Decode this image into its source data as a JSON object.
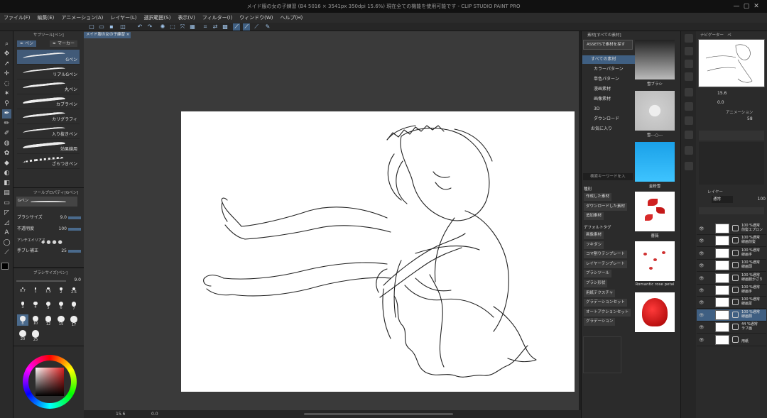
{
  "window": {
    "title": "メイド服の女の子練習 (B4 5016 × 3541px 350dpi 15.6%)  現在全ての機能を使用可能です - CLIP STUDIO PAINT PRO",
    "controls": [
      "—",
      "▢",
      "✕"
    ]
  },
  "menu": [
    "ファイル(F)",
    "編集(E)",
    "アニメーション(A)",
    "レイヤー(L)",
    "選択範囲(S)",
    "表示(V)",
    "フィルター(I)",
    "ウィンドウ(W)",
    "ヘルプ(H)"
  ],
  "document_tab": {
    "label": "メイド服の女の子練習",
    "close": "×"
  },
  "subtool_panel": {
    "header": "サブツール[ペン]",
    "tabs": [
      "ペン",
      "マーカー"
    ],
    "items": [
      "Gペン",
      "リアルGペン",
      "丸ペン",
      "カブラペン",
      "カリグラフィ",
      "入り抜きペン",
      "効果線用",
      "ざらつきペン"
    ],
    "selected": 0
  },
  "tool_property": {
    "header": "ツールプロパティ[Gペン]",
    "preset_label": "Gペン",
    "rows": [
      {
        "label": "ブラシサイズ",
        "value": "9.0"
      },
      {
        "label": "不透明度",
        "value": "100"
      },
      {
        "label": "アンチエイリアス",
        "value": ""
      },
      {
        "label": "手ブレ補正",
        "value": "25"
      }
    ]
  },
  "brush_size_panel": {
    "header": "ブラシサイズ[ペン]",
    "value": "9.0",
    "sizes": [
      "0.7",
      "1",
      "1.5",
      "2",
      "2.5",
      "3",
      "4",
      "5",
      "6",
      "7",
      "8",
      "10",
      "12",
      "15",
      "17",
      "20",
      "25"
    ],
    "selected": "8"
  },
  "material_panel": {
    "header": "素材[すべての素材]",
    "assets_button": "ASSETSで素材を探す",
    "tree": [
      "すべての素材",
      "カラーパターン",
      "単色パターン",
      "漫画素材",
      "画像素材",
      "3D",
      "ダウンロード",
      "お気に入り"
    ],
    "search_placeholder": "検索キーワードを入",
    "tag_section_1": "種別",
    "tag_buttons_1": [
      "作成した素材",
      "ダウンロードした素材",
      "追加素材"
    ],
    "tag_section_2": "デフォルトタグ",
    "tag_buttons_2": [
      "画像素材",
      "フキダシ",
      "コマ割りテンプレート",
      "レイヤーテンプレート",
      "ブラシツール",
      "ブラシ形状",
      "用紙テクスチャ",
      "グラデーションセット",
      "オートアクションセット",
      "グラデーション"
    ],
    "thumbnails": [
      "雪ブラシ",
      "雪---○---",
      "金粉雪",
      "薔薇",
      "Romantic rose petal",
      ""
    ]
  },
  "navigator": {
    "tabs": [
      "ナビゲーター",
      "ペ"
    ],
    "zoom": "15.6",
    "angle": "0.0"
  },
  "animation_panel": {
    "header": "アニメーション",
    "value": "58"
  },
  "layer_panel": {
    "header": "レイヤー",
    "blend_mode": "通常",
    "opacity": "100",
    "layers": [
      {
        "line1": "100 %通常",
        "line2": "前髪エプロン"
      },
      {
        "line1": "100 %通常",
        "line2": "線画前髪"
      },
      {
        "line1": "100 %通常",
        "line2": "線画手"
      },
      {
        "line1": "100 %通常",
        "line2": "線画頭"
      },
      {
        "line1": "100 %通常",
        "line2": "線画服かざり"
      },
      {
        "line1": "100 %通常",
        "line2": "線画手"
      },
      {
        "line1": "100 %通常",
        "line2": "線画足"
      },
      {
        "line1": "100 %通常",
        "line2": "線画顔"
      },
      {
        "line1": "44 %通常",
        "line2": "ラフ画"
      },
      {
        "line1": "",
        "line2": "用紙"
      }
    ],
    "selected": 7
  },
  "status": {
    "zoom": "15.6",
    "angle": "0.0"
  },
  "colors": {
    "accent": "#3f5f82",
    "main_color": "#000000",
    "sub_color": "#ffffff",
    "picker_base": "#e02020"
  }
}
